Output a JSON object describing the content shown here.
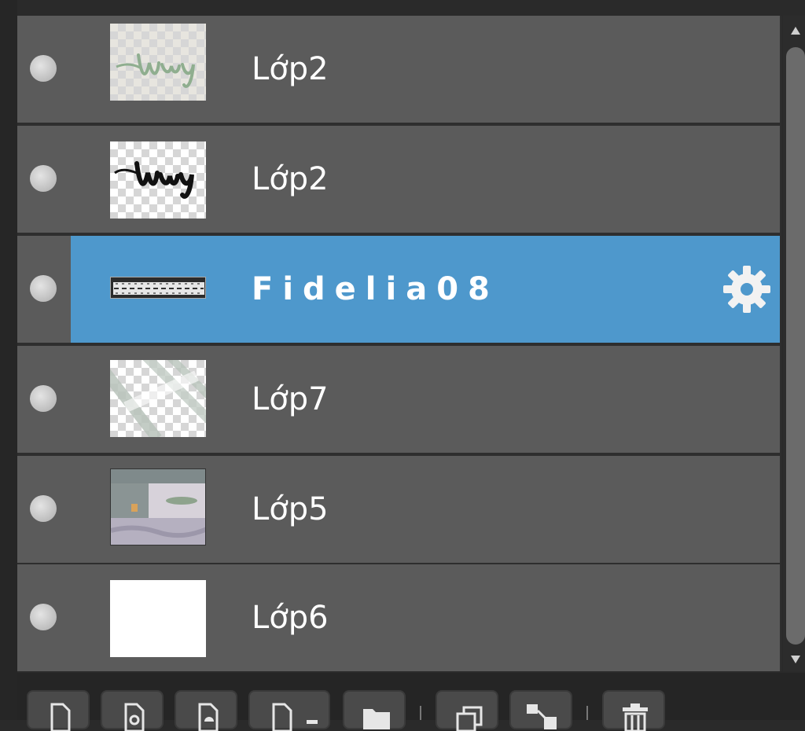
{
  "layers": [
    {
      "name": "Lớp2",
      "selected": false,
      "thumbnail": "green-script-text"
    },
    {
      "name": "Lớp2",
      "selected": false,
      "thumbnail": "black-script-text"
    },
    {
      "name": "Fidelia08",
      "selected": true,
      "thumbnail": "pattern-strip"
    },
    {
      "name": "Lớp7",
      "selected": false,
      "thumbnail": "diagonal-stripes"
    },
    {
      "name": "Lớp5",
      "selected": false,
      "thumbnail": "photo-scene"
    },
    {
      "name": "Lớp6",
      "selected": false,
      "thumbnail": "white-fill"
    }
  ],
  "toolbar": {
    "buttons": [
      {
        "icon": "new-layer-icon"
      },
      {
        "icon": "new-layer-from-icon"
      },
      {
        "icon": "new-adjustment-layer-icon"
      },
      {
        "icon": "new-layer-menu-icon"
      },
      {
        "icon": "new-folder-icon"
      },
      {
        "icon": "duplicate-layer-icon"
      },
      {
        "icon": "merge-layer-icon"
      },
      {
        "icon": "trash-icon"
      }
    ]
  },
  "colors": {
    "row_bg": "#5b5b5b",
    "selected_bg": "#4e98cc",
    "text": "#ffffff"
  }
}
